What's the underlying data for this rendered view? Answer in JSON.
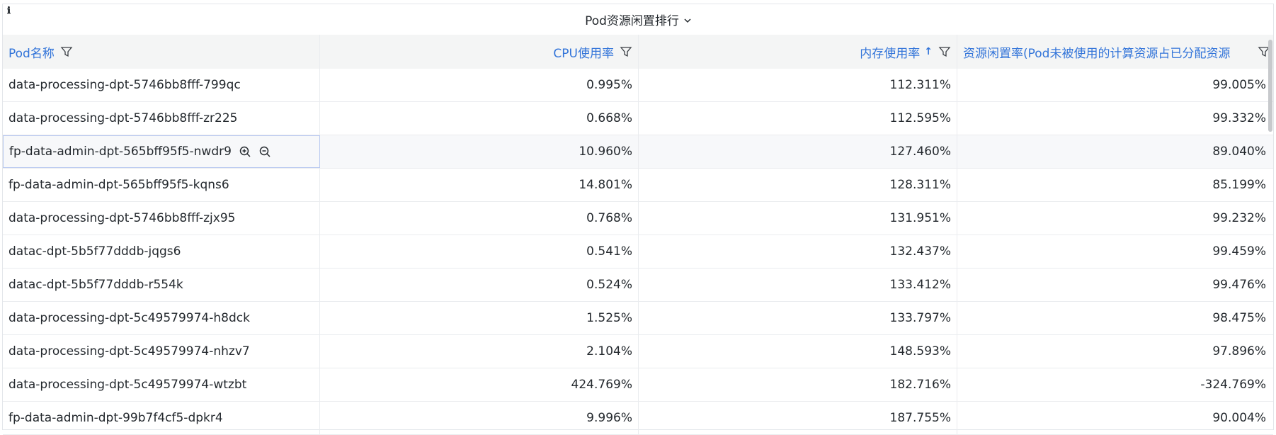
{
  "panel": {
    "title": "Pod资源闲置排行",
    "info_icon": "ℹ"
  },
  "table": {
    "columns": [
      {
        "label": "Pod名称"
      },
      {
        "label": "CPU使用率"
      },
      {
        "label": "内存使用率",
        "sort": "ascending"
      },
      {
        "label": "资源闲置率(Pod未被使用的计算资源占已分配资源"
      }
    ],
    "rows": [
      {
        "name": "data-processing-dpt-5746bb8fff-799qc",
        "cpu": "0.995%",
        "mem": "112.311%",
        "idle": "99.005%"
      },
      {
        "name": "data-processing-dpt-5746bb8fff-zr225",
        "cpu": "0.668%",
        "mem": "112.595%",
        "idle": "99.332%"
      },
      {
        "name": "fp-data-admin-dpt-565bff95f5-nwdr9",
        "cpu": "10.960%",
        "mem": "127.460%",
        "idle": "89.040%"
      },
      {
        "name": "fp-data-admin-dpt-565bff95f5-kqns6",
        "cpu": "14.801%",
        "mem": "128.311%",
        "idle": "85.199%"
      },
      {
        "name": "data-processing-dpt-5746bb8fff-zjx95",
        "cpu": "0.768%",
        "mem": "131.951%",
        "idle": "99.232%"
      },
      {
        "name": "datac-dpt-5b5f77dddb-jqgs6",
        "cpu": "0.541%",
        "mem": "132.437%",
        "idle": "99.459%"
      },
      {
        "name": "datac-dpt-5b5f77dddb-r554k",
        "cpu": "0.524%",
        "mem": "133.412%",
        "idle": "99.476%"
      },
      {
        "name": "data-processing-dpt-5c49579974-h8dck",
        "cpu": "1.525%",
        "mem": "133.797%",
        "idle": "98.475%"
      },
      {
        "name": "data-processing-dpt-5c49579974-nhzv7",
        "cpu": "2.104%",
        "mem": "148.593%",
        "idle": "97.896%"
      },
      {
        "name": "data-processing-dpt-5c49579974-wtzbt",
        "cpu": "424.769%",
        "mem": "182.716%",
        "idle": "-324.769%"
      },
      {
        "name": "fp-data-admin-dpt-99b7f4cf5-dpkr4",
        "cpu": "9.996%",
        "mem": "187.755%",
        "idle": "90.004%"
      }
    ]
  },
  "colors": {
    "header_text": "#3274d9",
    "header_bg": "#f4f5f5",
    "border": "#eaecef"
  }
}
